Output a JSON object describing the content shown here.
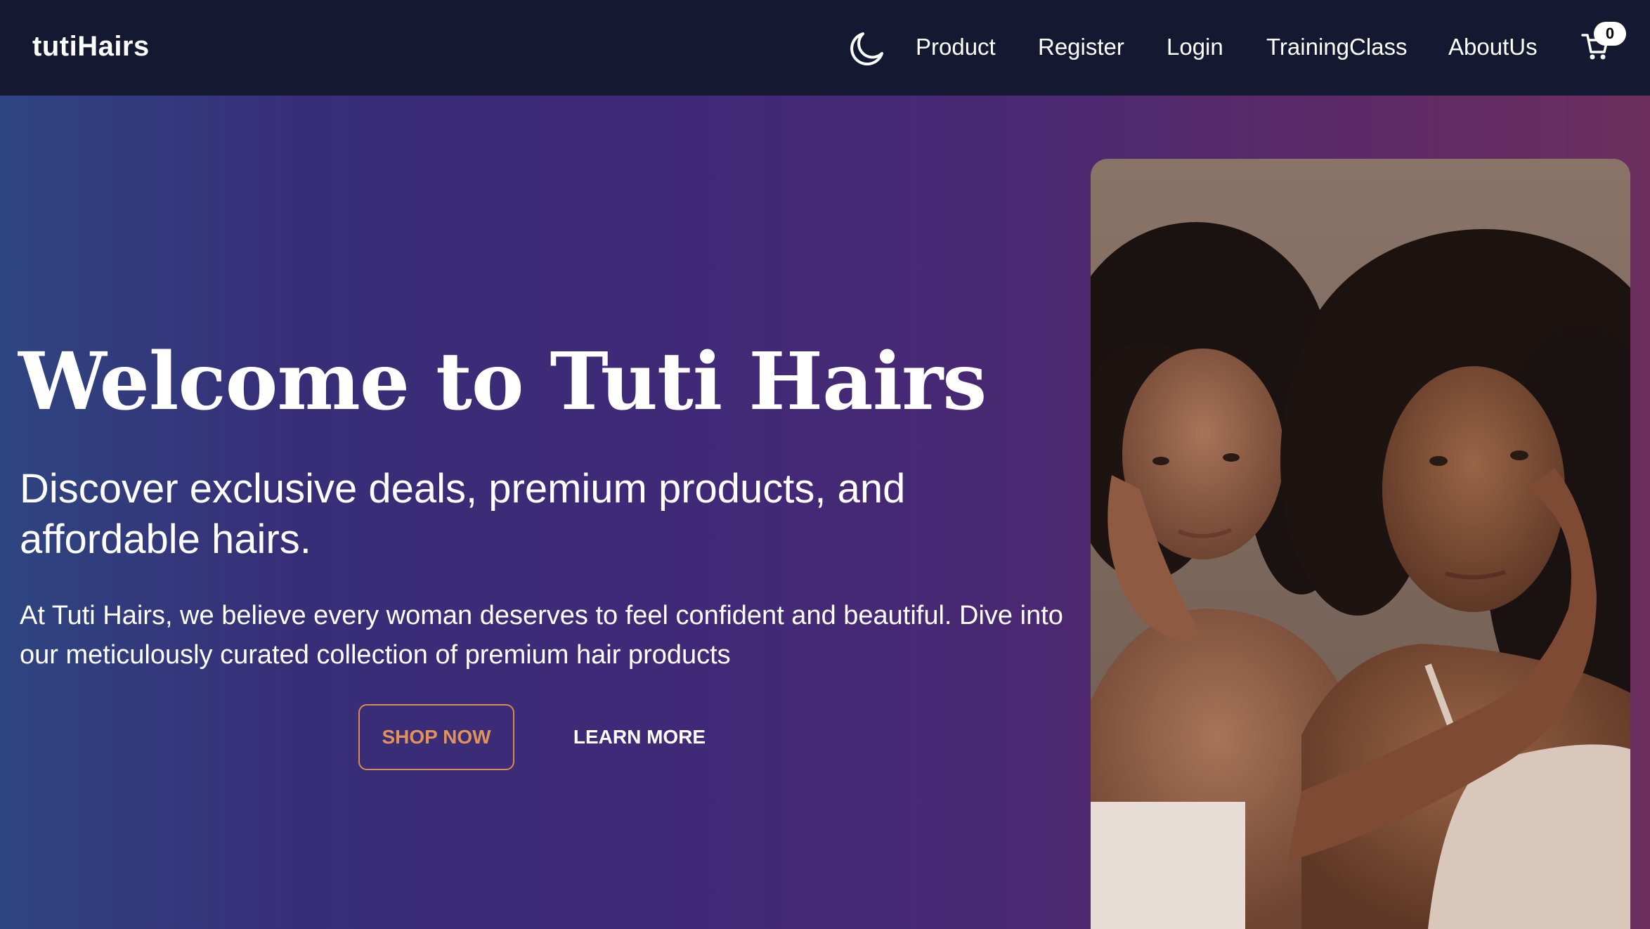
{
  "navbar": {
    "brand": "tutiHairs",
    "theme_toggle_icon": "moon-icon",
    "links": [
      "Product",
      "Register",
      "Login",
      "TrainingClass",
      "AboutUs"
    ],
    "cart_icon": "cart-icon",
    "cart_count": "0"
  },
  "hero": {
    "title": "Welcome to Tuti Hairs",
    "subtitle": "Discover exclusive deals, premium products, and affordable hairs.",
    "description": "At Tuti Hairs, we believe every woman deserves to feel confident and beautiful. Dive into our meticulously curated collection of premium hair products",
    "shop_button": "SHOP NOW",
    "learn_button": "LEARN MORE"
  },
  "colors": {
    "navbar_bg": "#141830",
    "accent": "#e0925a",
    "gradient_start": "#2e4580",
    "gradient_end": "#6d2e5e"
  }
}
